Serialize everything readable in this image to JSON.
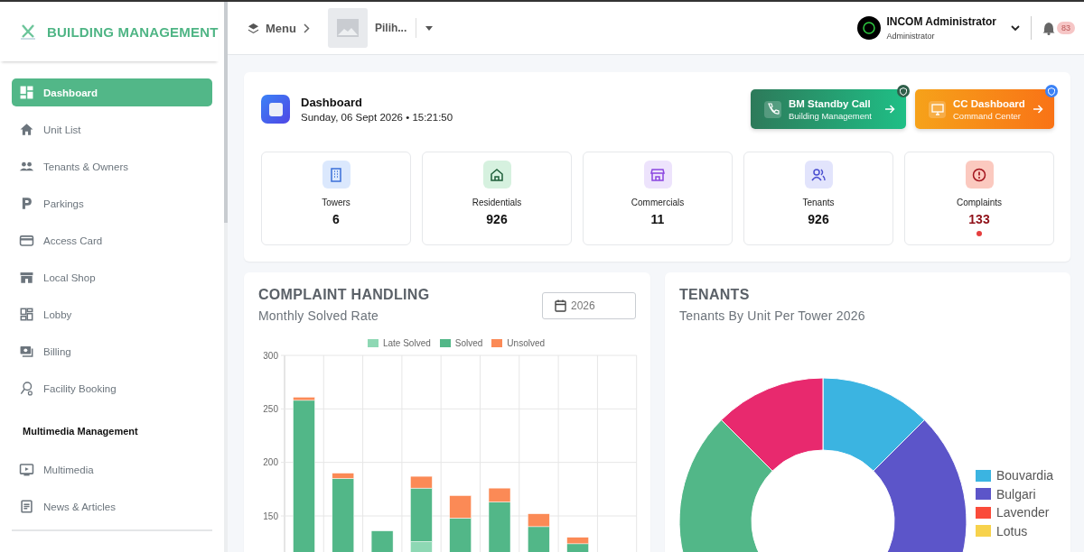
{
  "sidebar": {
    "brand": "BUILDING MANAGEMENT",
    "items": [
      {
        "kind": "item",
        "label": "Dashboard",
        "selected": true
      },
      {
        "kind": "item",
        "label": "Unit List",
        "selected": false
      },
      {
        "kind": "item",
        "label": "Tenants & Owners",
        "selected": false
      },
      {
        "kind": "item",
        "label": "Parkings",
        "selected": false
      },
      {
        "kind": "item",
        "label": "Access Card",
        "selected": false
      },
      {
        "kind": "item",
        "label": "Local Shop",
        "selected": false
      },
      {
        "kind": "item",
        "label": "Lobby",
        "selected": false
      },
      {
        "kind": "item",
        "label": "Billing",
        "selected": false
      },
      {
        "kind": "item",
        "label": "Facility Booking",
        "selected": false
      },
      {
        "kind": "section",
        "label": "Multimedia Management"
      },
      {
        "kind": "item",
        "label": "Multimedia",
        "selected": false
      },
      {
        "kind": "item",
        "label": "News & Articles",
        "selected": false
      }
    ]
  },
  "header": {
    "menu": "Menu",
    "select": {
      "value": "Pilih..."
    },
    "user": {
      "name": "INCOM Administrator",
      "role": "Administrator"
    },
    "notifications": "83"
  },
  "dashboard": {
    "title": "Dashboard",
    "datetime": "Sunday, 06 Sept 2026 • 15:21:50",
    "actions": [
      {
        "kind": "standby",
        "title": "BM Standby Call",
        "subtitle": "Building Management"
      },
      {
        "kind": "command",
        "title": "CC Dashboard",
        "subtitle": "Command Center"
      }
    ],
    "stats": [
      {
        "label": "Towers",
        "value": "6",
        "alert": false
      },
      {
        "label": "Residentials",
        "value": "926",
        "alert": false
      },
      {
        "label": "Commercials",
        "value": "11",
        "alert": false
      },
      {
        "label": "Tenants",
        "value": "926",
        "alert": false
      },
      {
        "label": "Complaints",
        "value": "133",
        "alert": true
      }
    ]
  },
  "complaints": {
    "title": "COMPLAINT HANDLING",
    "subtitle": "Monthly Solved Rate",
    "year": "2026",
    "chart_data": {
      "type": "bar",
      "stacked": true,
      "grid": true,
      "ylim": [
        0,
        300
      ],
      "yticks": [
        150,
        200,
        250,
        300
      ],
      "series": [
        {
          "name": "Late Solved",
          "color": "#8ed8b4",
          "values": [
            0,
            0,
            0,
            126,
            0,
            0,
            0,
            0,
            null
          ]
        },
        {
          "name": "Solved",
          "color": "#52b788",
          "values": [
            258,
            185,
            136,
            50,
            148,
            163,
            140,
            124,
            null
          ]
        },
        {
          "name": "Unsolved",
          "color": "#fb8a56",
          "values": [
            3,
            5,
            0,
            11,
            21,
            13,
            12,
            6,
            null
          ]
        }
      ]
    }
  },
  "tenants": {
    "title": "TENANTS",
    "subtitle": "Tenants By Unit Per Tower 2026",
    "legend": [
      {
        "label": "Bouvardia",
        "color": "#3bb4e1"
      },
      {
        "label": "Bulgari",
        "color": "#5c55c9"
      },
      {
        "label": "Lavender",
        "color": "#fa4b3a"
      },
      {
        "label": "Lotus",
        "color": "#f7d24c"
      }
    ]
  }
}
